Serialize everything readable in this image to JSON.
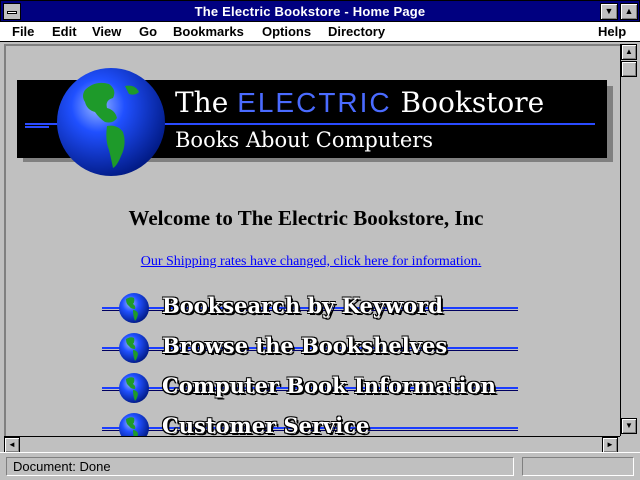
{
  "window": {
    "title": "The Electric Bookstore - Home Page"
  },
  "menu": {
    "file": "File",
    "edit": "Edit",
    "view": "View",
    "go": "Go",
    "bookmarks": "Bookmarks",
    "options": "Options",
    "directory": "Directory",
    "help": "Help"
  },
  "banner": {
    "title_pre": "The ",
    "title_highlight": "ELECTRIC",
    "title_post": " Bookstore",
    "subtitle": "Books About Computers"
  },
  "page": {
    "welcome": "Welcome to The Electric Bookstore, Inc",
    "shipping_link": "Our Shipping rates have changed, click here for information."
  },
  "nav": [
    {
      "label": "Booksearch by Keyword"
    },
    {
      "label": "Browse the Bookshelves"
    },
    {
      "label": "Computer Book Information"
    },
    {
      "label": "Customer Service"
    }
  ],
  "status": {
    "text": "Document: Done"
  },
  "colors": {
    "titlebar": "#000080",
    "link": "#0000ff",
    "accent_blue": "#2a4bff"
  }
}
